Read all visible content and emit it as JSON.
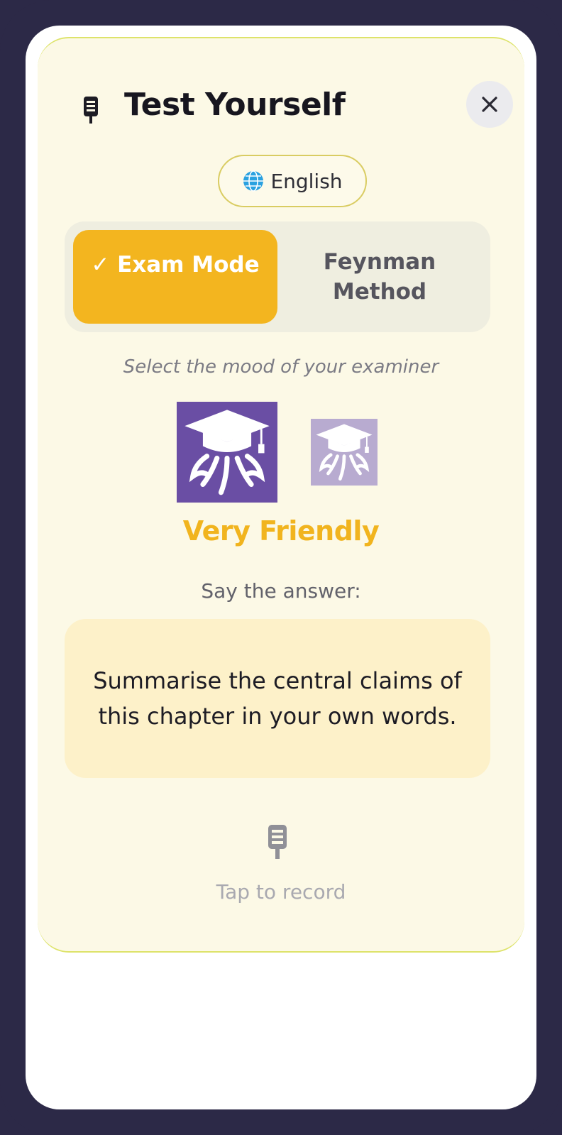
{
  "header": {
    "title": "Test Yourself",
    "mic_icon": "microphone-icon",
    "close_icon": "close-icon"
  },
  "language": {
    "icon": "globe-icon",
    "label": "English"
  },
  "modes": [
    {
      "label": "✓ Exam Mode",
      "selected": true
    },
    {
      "label": "Feynman Method",
      "selected": false
    }
  ],
  "mood": {
    "hint": "Select the mood of your examiner",
    "options": [
      {
        "icon": "octopus-graduation-cap-icon",
        "selected": true
      },
      {
        "icon": "octopus-graduation-cap-icon",
        "selected": false
      }
    ],
    "selected_label": "Very Friendly"
  },
  "prompt": {
    "label": "Say the answer:",
    "question": "Summarise the central claims of this chapter in your own words."
  },
  "record": {
    "icon": "microphone-icon",
    "label": "Tap to record"
  },
  "colors": {
    "frame": "#2c2947",
    "sheet": "#fcf9e6",
    "accent": "#f3b51f",
    "mood_selected_bg": "#6a4ea4",
    "mood_other_bg": "#b8abd0",
    "card": "#fdf1c9"
  }
}
